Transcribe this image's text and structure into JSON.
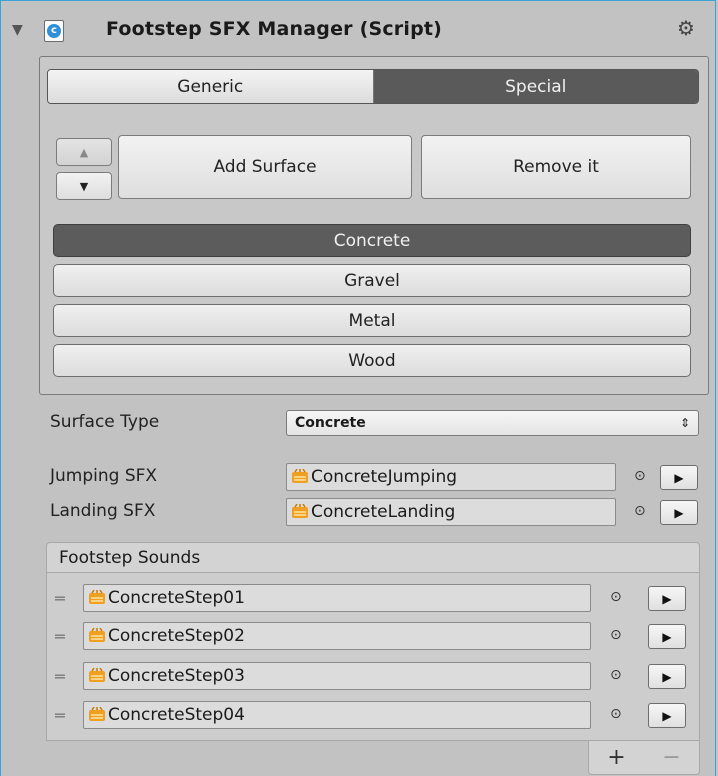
{
  "component": {
    "title": "Footstep SFX Manager (Script)",
    "foldout_icon": "triangle-down-icon",
    "script_icon": "csharp-script-icon",
    "settings_icon": "gear-icon",
    "foldout_glyph": "▼",
    "script_glyph": "c",
    "gear_glyph": "⚙"
  },
  "tabs": [
    {
      "label": "Generic",
      "selected": false
    },
    {
      "label": "Special",
      "selected": true
    }
  ],
  "controls": {
    "move_up_glyph": "▲",
    "move_down_glyph": "▼",
    "add_label": "Add Surface",
    "remove_label": "Remove it"
  },
  "surfaces": [
    {
      "label": "Concrete",
      "selected": true
    },
    {
      "label": "Gravel",
      "selected": false
    },
    {
      "label": "Metal",
      "selected": false
    },
    {
      "label": "Wood",
      "selected": false
    }
  ],
  "fields": {
    "surface_type_label": "Surface Type",
    "surface_type_value": "Concrete",
    "dropdown_glyph": "⇕",
    "jumping_label": "Jumping SFX",
    "jumping_value": "ConcreteJumping",
    "landing_label": "Landing SFX",
    "landing_value": "ConcreteLanding",
    "picker_glyph": "⊙",
    "play_glyph": "▶"
  },
  "footstep_list": {
    "header": "Footstep Sounds",
    "handle_glyph": "═",
    "items": [
      "ConcreteStep01",
      "ConcreteStep02",
      "ConcreteStep03",
      "ConcreteStep04"
    ],
    "add_glyph": "+",
    "remove_glyph": "−"
  },
  "colors": {
    "accent_border": "#3aa4d8",
    "selected_bg": "#5c5c5c",
    "audio_icon": "#f0a020"
  }
}
